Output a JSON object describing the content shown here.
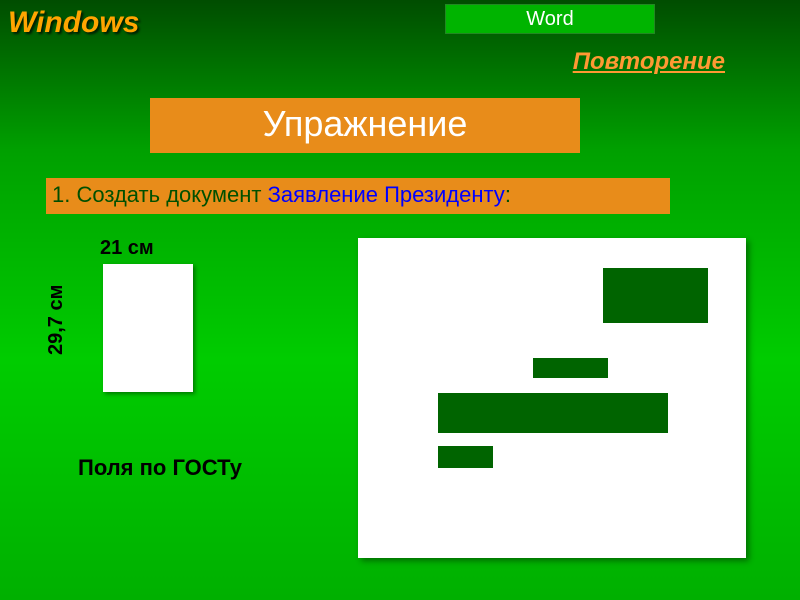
{
  "header": {
    "left": "Windows",
    "right": "Word",
    "sub": "Повторение"
  },
  "exercise": {
    "title": "Упражнение",
    "task_num": "1.",
    "task_text1": "Создать документ ",
    "task_text2": "Заявление Президенту",
    "task_colon": ":"
  },
  "page": {
    "width_label": "21 см",
    "height_label": "29,7 см",
    "margins_label": "Поля по ГОСТу"
  }
}
